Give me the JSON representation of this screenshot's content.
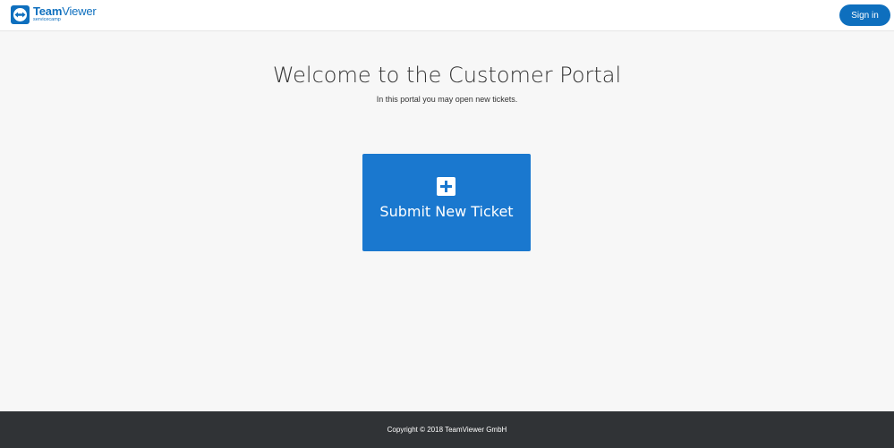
{
  "header": {
    "logo": {
      "name_bold": "Team",
      "name_rest": "Viewer",
      "sub": "servicecamp",
      "icon": "teamviewer-logo-icon"
    },
    "signin_label": "Sign in"
  },
  "main": {
    "title": "Welcome to the Customer Portal",
    "subtitle": "In this portal you may open new tickets.",
    "tile": {
      "label": "Submit New Ticket",
      "icon": "plus-square-icon"
    }
  },
  "footer": {
    "copyright": "Copyright © 2018 TeamViewer GmbH"
  },
  "colors": {
    "brand": "#0e6fbe",
    "tile": "#1a78cf",
    "background": "#f7f7f7",
    "footer": "#303336"
  }
}
